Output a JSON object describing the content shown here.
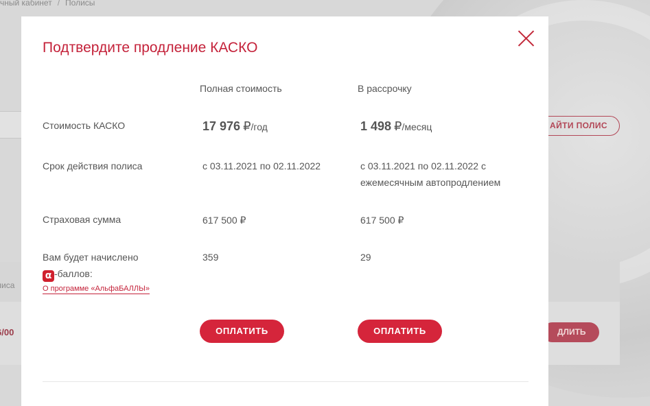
{
  "background": {
    "breadcrumb": {
      "item1": "чный кабинет",
      "separator": "/",
      "item2": "Полисы"
    },
    "find_policy_button": "АЙТИ ПОЛИС",
    "table_column_label": "лиса",
    "policy_number": "6/00",
    "renew_button": "ДЛИТЬ",
    "brand_color": "#c4223a"
  },
  "modal": {
    "title": "Подтвердите продление КАСКО",
    "close_icon": "close-icon",
    "columns": {
      "full": "Полная стоимость",
      "installment": "В рассрочку"
    },
    "rows": {
      "cost": {
        "label": "Стоимость КАСКО",
        "full_amount": "17 976",
        "full_currency": "₽",
        "full_period": "/год",
        "installment_amount": "1 498",
        "installment_currency": "₽",
        "installment_period": "/месяц"
      },
      "term": {
        "label": "Срок действия полиса",
        "full": "с 03.11.2021 по 02.11.2022",
        "installment_line1": "с 03.11.2021 по 02.11.2022 с",
        "installment_line2": "ежемесячным автопродлением"
      },
      "sum_insured": {
        "label": "Страховая сумма",
        "full": "617 500 ₽",
        "installment": "617 500 ₽"
      },
      "points": {
        "label_line1": "Вам будет начислено",
        "logo_letter": "α",
        "label_line2_suffix": "-баллов:",
        "full": "359",
        "installment": "29",
        "program_link": "О программе «АльфаБАЛЛЫ»"
      }
    },
    "pay_button": "ОПЛАТИТЬ"
  }
}
